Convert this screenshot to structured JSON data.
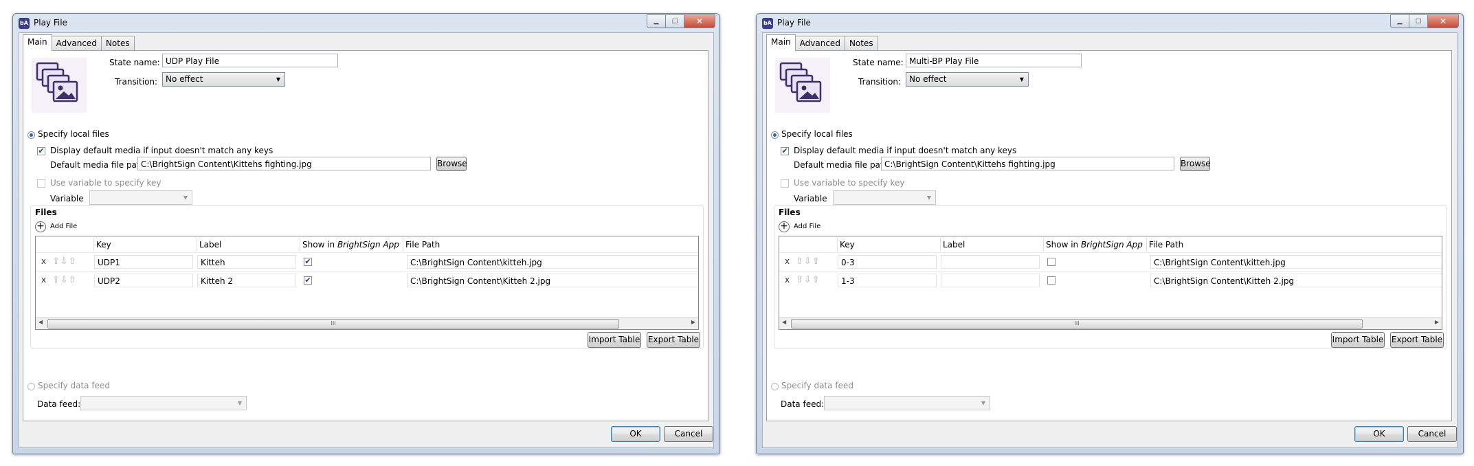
{
  "windows": [
    {
      "title": "Play File",
      "app_icon": "bA",
      "tabs": [
        "Main",
        "Advanced",
        "Notes"
      ],
      "state_name_label": "State name:",
      "state_name": "UDP Play File",
      "transition_label": "Transition:",
      "transition": "No effect",
      "specify_local_files": "Specify local files",
      "display_default_label": "Display default media if input doesn't match any keys",
      "display_default_checked": true,
      "default_media_label": "Default media file path",
      "default_media_path": "C:\\BrightSign Content\\Kittehs fighting.jpg",
      "browse": "Browse",
      "use_variable_label": "Use variable to specify key",
      "variable_label": "Variable",
      "files_group": "Files",
      "add_file": "Add File",
      "columns": {
        "key": "Key",
        "label": "Label",
        "show_prefix": "Show in ",
        "show_italic": "BrightSign App",
        "path": "File Path"
      },
      "rows": [
        {
          "delete": "x",
          "key": "UDP1",
          "label": "Kitteh",
          "show": true,
          "path": "C:\\BrightSign Content\\kitteh.jpg"
        },
        {
          "delete": "x",
          "key": "UDP2",
          "label": "Kitteh 2",
          "show": true,
          "path": "C:\\BrightSign Content\\Kitteh 2.jpg"
        }
      ],
      "scroll_grip": "III",
      "import_table": "Import Table",
      "export_table": "Export Table",
      "specify_data_feed": "Specify data feed",
      "data_feed_label": "Data feed:",
      "ok": "OK",
      "cancel": "Cancel"
    },
    {
      "title": "Play File",
      "app_icon": "bA",
      "tabs": [
        "Main",
        "Advanced",
        "Notes"
      ],
      "state_name_label": "State name:",
      "state_name": "Multi-BP Play File",
      "transition_label": "Transition:",
      "transition": "No effect",
      "specify_local_files": "Specify local files",
      "display_default_label": "Display default media if input doesn't match any keys",
      "display_default_checked": true,
      "default_media_label": "Default media file path",
      "default_media_path": "C:\\BrightSign Content\\Kittehs fighting.jpg",
      "browse": "Browse",
      "use_variable_label": "Use variable to specify key",
      "variable_label": "Variable",
      "files_group": "Files",
      "add_file": "Add File",
      "columns": {
        "key": "Key",
        "label": "Label",
        "show_prefix": "Show in ",
        "show_italic": "BrightSign App",
        "path": "File Path"
      },
      "rows": [
        {
          "delete": "x",
          "key": "0-3",
          "label": "",
          "show": false,
          "path": "C:\\BrightSign Content\\kitteh.jpg"
        },
        {
          "delete": "x",
          "key": "1-3",
          "label": "",
          "show": false,
          "path": "C:\\BrightSign Content\\Kitteh 2.jpg"
        }
      ],
      "scroll_grip": "III",
      "import_table": "Import Table",
      "export_table": "Export Table",
      "specify_data_feed": "Specify data feed",
      "data_feed_label": "Data feed:",
      "ok": "OK",
      "cancel": "Cancel"
    }
  ],
  "icons": {
    "minimize": "minimize-icon",
    "maximize": "maximize-icon",
    "close": "close-icon",
    "state": "media-stack-icon",
    "add": "plus-circle-icon",
    "reorder": "arrow-up-down-icons"
  },
  "colors": {
    "accent": "#2a64b8",
    "close_button": "#c74a35",
    "window_frame": "#c8d6e8"
  }
}
